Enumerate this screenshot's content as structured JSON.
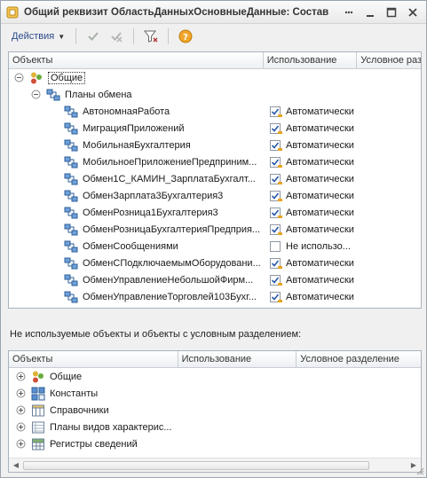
{
  "window": {
    "title": "Общий реквизит ОбластьДанныхОсновныеДанные: Состав"
  },
  "toolbar": {
    "actions_label": "Действия"
  },
  "top_table": {
    "columns": [
      "Объекты",
      "Использование",
      "Условное разделение"
    ],
    "root_label": "Общие",
    "group_label": "Планы обмена",
    "items": [
      {
        "name": "АвтономнаяРабота",
        "usage": "Автоматически",
        "checked": true
      },
      {
        "name": "МиграцияПриложений",
        "usage": "Автоматически",
        "checked": true
      },
      {
        "name": "МобильнаяБухгалтерия",
        "usage": "Автоматически",
        "checked": true
      },
      {
        "name": "МобильноеПриложениеПредприним...",
        "usage": "Автоматически",
        "checked": true
      },
      {
        "name": "Обмен1С_КАМИН_ЗарплатаБухгалт...",
        "usage": "Автоматически",
        "checked": true
      },
      {
        "name": "ОбменЗарплата3Бухгалтерия3",
        "usage": "Автоматически",
        "checked": true
      },
      {
        "name": "ОбменРозница1Бухгалтерия3",
        "usage": "Автоматически",
        "checked": true
      },
      {
        "name": "ОбменРозницаБухгалтерияПредприя...",
        "usage": "Автоматически",
        "checked": true
      },
      {
        "name": "ОбменСообщениями",
        "usage": "Не использо...",
        "checked": false
      },
      {
        "name": "ОбменСПодключаемымОборудовани...",
        "usage": "Автоматически",
        "checked": true
      },
      {
        "name": "ОбменУправлениеНебольшойФирм...",
        "usage": "Автоматически",
        "checked": true
      },
      {
        "name": "ОбменУправлениеТорговлей103Бухг...",
        "usage": "Автоматически",
        "checked": true
      }
    ]
  },
  "section_label": "Не используемые объекты и объекты с условным разделением:",
  "bottom_table": {
    "columns": [
      "Объекты",
      "Использование",
      "Условное разделение"
    ],
    "items": [
      {
        "name": "Общие",
        "icon": "common-icon"
      },
      {
        "name": "Константы",
        "icon": "constants-icon"
      },
      {
        "name": "Справочники",
        "icon": "catalogs-icon"
      },
      {
        "name": "Планы видов характерис...",
        "icon": "chart-of-characteristics-icon"
      },
      {
        "name": "Регистры сведений",
        "icon": "info-registers-icon"
      }
    ]
  }
}
